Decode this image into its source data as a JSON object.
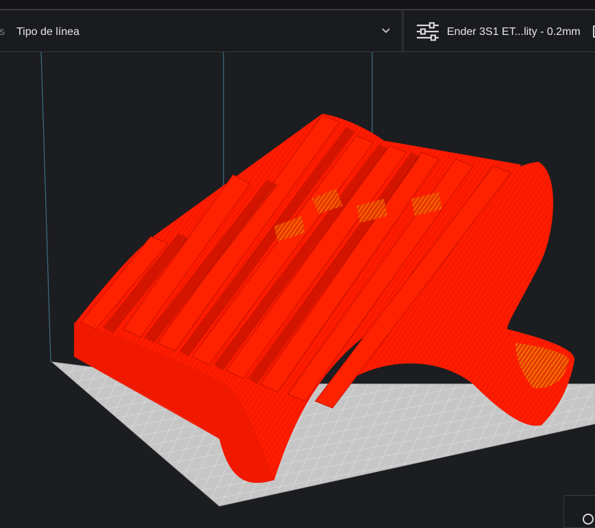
{
  "toolbar": {
    "left_panel": {
      "truncated_text": "s",
      "label": "Tipo de línea",
      "dropdown_icon": "chevron-down-icon"
    },
    "right_panel": {
      "settings_icon": "sliders-icon",
      "label": "Ender 3S1 ET...lity - 0.2mm"
    }
  },
  "viewport": {
    "object": "sliced-model-preview",
    "colors": {
      "background": "#1c1d20",
      "build_plate": "#c8c8c8",
      "model_wall": "#ff1a00",
      "model_infill": "#e8e000"
    }
  },
  "corner_button_icon": "clock-icon"
}
